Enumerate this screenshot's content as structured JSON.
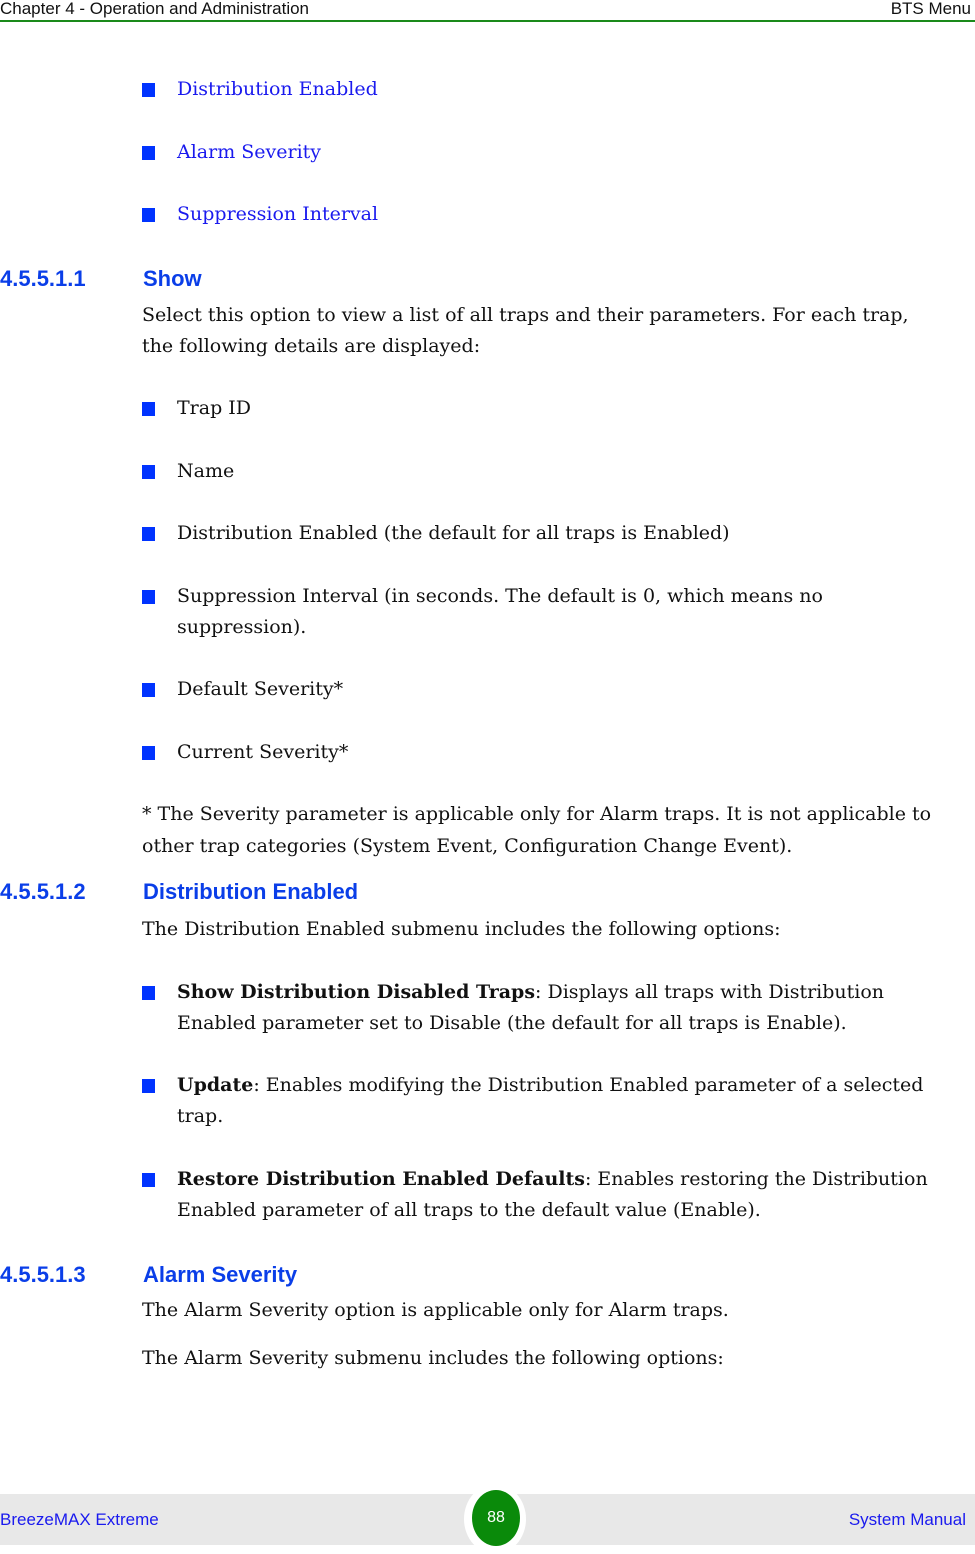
{
  "header": {
    "chapter": "Chapter 4 - Operation and Administration",
    "section": "BTS Menu"
  },
  "top_links": [
    "Distribution Enabled",
    "Alarm Severity",
    "Suppression Interval"
  ],
  "sections": {
    "show": {
      "number": "4.5.5.1.1",
      "title": "Show",
      "intro_line1": "Select this option to view a list of all traps and their parameters. For each trap,",
      "intro_line2": "the following details are displayed:",
      "items": [
        {
          "line1": "Trap ID"
        },
        {
          "line1": "Name"
        },
        {
          "line1": "Distribution Enabled (the default for all traps is Enabled)"
        },
        {
          "line1": "Suppression Interval (in seconds. The default is 0, which means no",
          "line2": "suppression)."
        },
        {
          "line1": "Default Severity*"
        },
        {
          "line1": "Current Severity*"
        }
      ],
      "note_line1": "* The Severity parameter is applicable only for Alarm traps. It is not applicable to",
      "note_line2": "other trap categories (System Event, Configuration Change Event)."
    },
    "distribution": {
      "number": "4.5.5.1.2",
      "title": "Distribution Enabled",
      "intro": "The Distribution Enabled submenu includes the following options:",
      "items": [
        {
          "term": "Show Distribution Disabled Traps",
          "rest1": ": Displays all traps with Distribution",
          "line2": "Enabled parameter set to Disable (the default for all traps is Enable)."
        },
        {
          "term": "Update",
          "rest1": ": Enables modifying the Distribution Enabled parameter of a selected",
          "line2": "trap."
        },
        {
          "term": "Restore Distribution Enabled Defaults",
          "rest1": ": Enables restoring the Distribution",
          "line2": "Enabled parameter of all traps to the default value (Enable)."
        }
      ]
    },
    "alarm": {
      "number": "4.5.5.1.3",
      "title": "Alarm Severity",
      "para1": "The Alarm Severity option is applicable only for Alarm traps.",
      "para2": "The Alarm Severity submenu includes the following options:"
    }
  },
  "footer": {
    "product": "BreezeMAX Extreme",
    "page": "88",
    "doc": "System Manual"
  },
  "colors": {
    "accent_blue": "#0a3ee8",
    "link_blue": "#1a1aee",
    "bullet_blue": "#0033ff",
    "rule_green": "#1a8a1a",
    "page_green": "#0a8a0a"
  }
}
